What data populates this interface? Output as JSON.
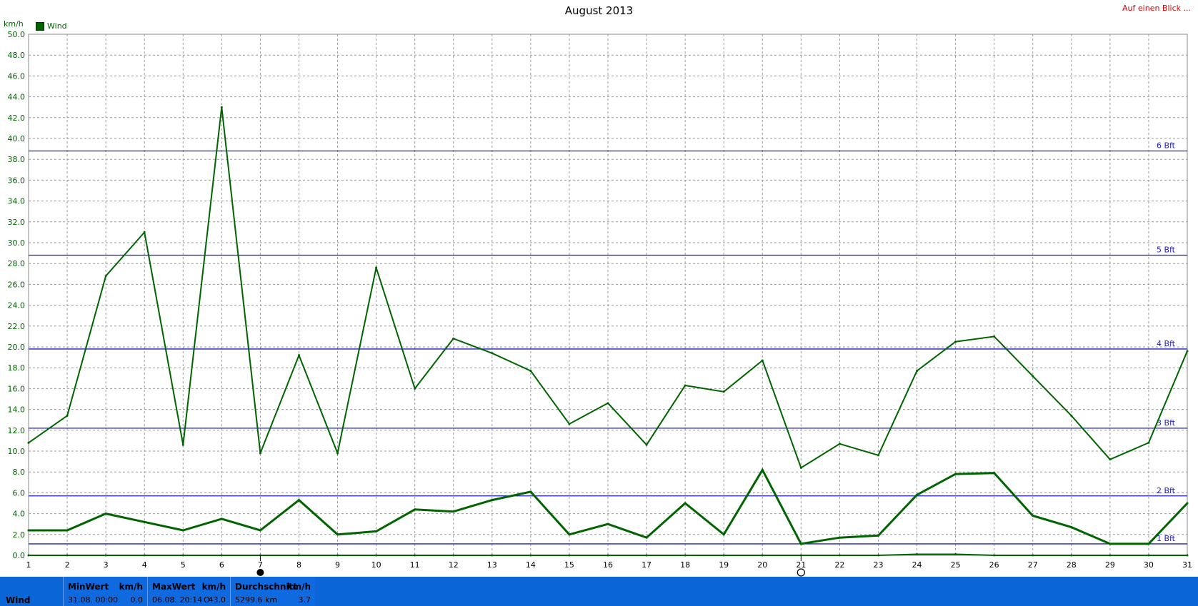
{
  "header": {
    "title": "August 2013",
    "top_right_link": "Auf einen Blick ...",
    "y_unit": "km/h",
    "legend_label": "Wind"
  },
  "colors": {
    "series": "#006400",
    "reference_lines": "#1e1ecc",
    "footer_bg": "#0a66d6",
    "link": "#e00000"
  },
  "chart_data": {
    "type": "line",
    "title": "August 2013",
    "xlabel": "",
    "ylabel": "km/h",
    "ylim": [
      0,
      50
    ],
    "xlim": [
      1,
      31
    ],
    "y_ticks": [
      "0.0",
      "2.0",
      "4.0",
      "6.0",
      "8.0",
      "10.0",
      "12.0",
      "14.0",
      "16.0",
      "18.0",
      "20.0",
      "22.0",
      "24.0",
      "26.0",
      "28.0",
      "30.0",
      "32.0",
      "34.0",
      "36.0",
      "38.0",
      "40.0",
      "42.0",
      "44.0",
      "46.0",
      "48.0",
      "50.0"
    ],
    "x_ticks": [
      "1",
      "2",
      "3",
      "4",
      "5",
      "6",
      "7",
      "8",
      "9",
      "10",
      "11",
      "12",
      "13",
      "14",
      "15",
      "16",
      "17",
      "18",
      "19",
      "20",
      "21",
      "22",
      "23",
      "24",
      "25",
      "26",
      "27",
      "28",
      "29",
      "30",
      "31"
    ],
    "grid": true,
    "legend": "top-left",
    "series": [
      {
        "name": "Wind",
        "role": "max",
        "x": [
          1,
          2,
          3,
          4,
          5,
          6,
          7,
          8,
          9,
          10,
          11,
          12,
          13,
          14,
          15,
          16,
          17,
          18,
          19,
          20,
          21,
          22,
          23,
          24,
          25,
          26,
          27,
          28,
          29,
          30,
          31
        ],
        "values": [
          10.8,
          13.4,
          26.8,
          31.0,
          10.6,
          43.0,
          9.8,
          19.2,
          9.8,
          27.6,
          16.0,
          20.8,
          19.4,
          17.7,
          12.6,
          14.6,
          10.6,
          16.3,
          15.7,
          18.7,
          8.4,
          10.7,
          9.6,
          17.7,
          20.5,
          21.0,
          17.2,
          13.4,
          9.2,
          10.8,
          19.6
        ]
      },
      {
        "name": "Wind",
        "role": "average",
        "x": [
          1,
          2,
          3,
          4,
          5,
          6,
          7,
          8,
          9,
          10,
          11,
          12,
          13,
          14,
          15,
          16,
          17,
          18,
          19,
          20,
          21,
          22,
          23,
          24,
          25,
          26,
          27,
          28,
          29,
          30,
          31
        ],
        "values": [
          2.4,
          2.4,
          4.0,
          3.2,
          2.4,
          3.5,
          2.4,
          5.3,
          2.0,
          2.3,
          4.4,
          4.2,
          5.3,
          6.1,
          2.0,
          3.0,
          1.7,
          5.0,
          2.0,
          8.2,
          1.1,
          1.7,
          1.9,
          5.8,
          7.8,
          7.9,
          3.8,
          2.7,
          1.1,
          1.1,
          5.0
        ]
      },
      {
        "name": "Wind",
        "role": "min",
        "x": [
          1,
          2,
          3,
          4,
          5,
          6,
          7,
          8,
          9,
          10,
          11,
          12,
          13,
          14,
          15,
          16,
          17,
          18,
          19,
          20,
          21,
          22,
          23,
          24,
          25,
          26,
          27,
          28,
          29,
          30,
          31
        ],
        "values": [
          0,
          0,
          0,
          0,
          0,
          0,
          0,
          0,
          0,
          0,
          0,
          0,
          0,
          0,
          0,
          0,
          0,
          0,
          0,
          0,
          0,
          0,
          0,
          0.1,
          0.1,
          0,
          0,
          0,
          0,
          0,
          0
        ]
      }
    ],
    "reference_lines": [
      {
        "label": "1 Bft",
        "value": 1.1
      },
      {
        "label": "2 Bft",
        "value": 5.7
      },
      {
        "label": "3 Bft",
        "value": 12.2
      },
      {
        "label": "4 Bft",
        "value": 19.8
      },
      {
        "label": "5 Bft",
        "value": 28.8
      },
      {
        "label": "6 Bft",
        "value": 38.8
      }
    ],
    "markers": [
      {
        "day": 7,
        "icon": "filled-circle-icon"
      },
      {
        "day": 21,
        "icon": "open-circle-icon"
      }
    ]
  },
  "footer": {
    "row_name": "Wind",
    "min": {
      "header": "MinWert",
      "unit": "km/h",
      "date": "31.08.  00:00",
      "value": "0.0"
    },
    "max": {
      "header": "MaxWert",
      "unit": "km/h",
      "date": "06.08.  20:14",
      "dir": "O",
      "value": "43.0"
    },
    "avg": {
      "header": "Durchschnitt",
      "unit": "km/h",
      "total": "5299.6 km",
      "value": "3.7"
    }
  }
}
